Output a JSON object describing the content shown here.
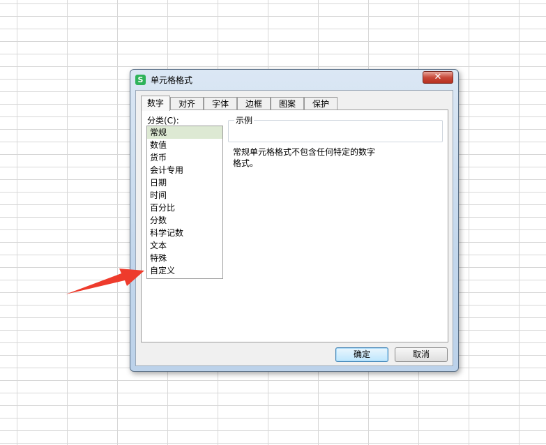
{
  "dialog": {
    "title": "单元格格式",
    "app_icon_glyph": "S",
    "close_glyph": "✕"
  },
  "tabs": [
    {
      "label": "数字",
      "active": true
    },
    {
      "label": "对齐",
      "active": false
    },
    {
      "label": "字体",
      "active": false
    },
    {
      "label": "边框",
      "active": false
    },
    {
      "label": "图案",
      "active": false
    },
    {
      "label": "保护",
      "active": false
    }
  ],
  "category": {
    "label": "分类(C):",
    "selected": "常规",
    "items": [
      "常规",
      "数值",
      "货币",
      "会计专用",
      "日期",
      "时间",
      "百分比",
      "分数",
      "科学记数",
      "文本",
      "特殊",
      "自定义"
    ]
  },
  "sample": {
    "label": "示例"
  },
  "description": "常规单元格格式不包含任何特定的数字格式。",
  "buttons": {
    "ok": "确定",
    "cancel": "取消"
  },
  "colors": {
    "arrow": "#ee3b2c",
    "selection": "#dde9d3",
    "app_icon": "#2eb35a"
  }
}
